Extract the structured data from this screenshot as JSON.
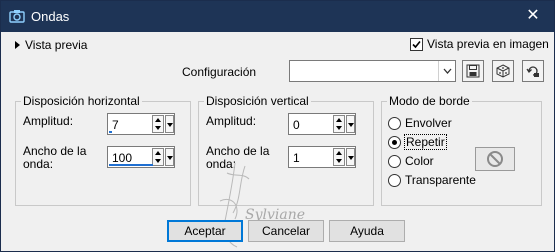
{
  "window": {
    "title": "Ondas",
    "close_glyph": "✕",
    "icon": "camera-icon"
  },
  "preview": {
    "toggle_label": "Vista previa",
    "checkbox_label": "Vista previa en imagen",
    "checkbox_checked": true
  },
  "config": {
    "label": "Configuración",
    "value": "",
    "buttons": [
      "save-icon",
      "dice-icon",
      "reset-icon"
    ]
  },
  "horizontal": {
    "title": "Disposición horizontal",
    "amplitude_label": "Amplitud:",
    "amplitude_value": "7",
    "width_label_1": "Ancho de la",
    "width_label_2": "onda:",
    "width_value": "100"
  },
  "vertical": {
    "title": "Disposición vertical",
    "amplitude_label": "Amplitud:",
    "amplitude_value": "0",
    "width_label_1": "Ancho de la",
    "width_label_2": "onda:",
    "width_value": "1"
  },
  "edge": {
    "title": "Modo de borde",
    "options": [
      "Envolver",
      "Repetir",
      "Color",
      "Transparente"
    ],
    "selected": "Repetir"
  },
  "buttons": {
    "accept": "Aceptar",
    "cancel": "Cancelar",
    "help": "Ayuda"
  },
  "watermark": "Sylviane"
}
